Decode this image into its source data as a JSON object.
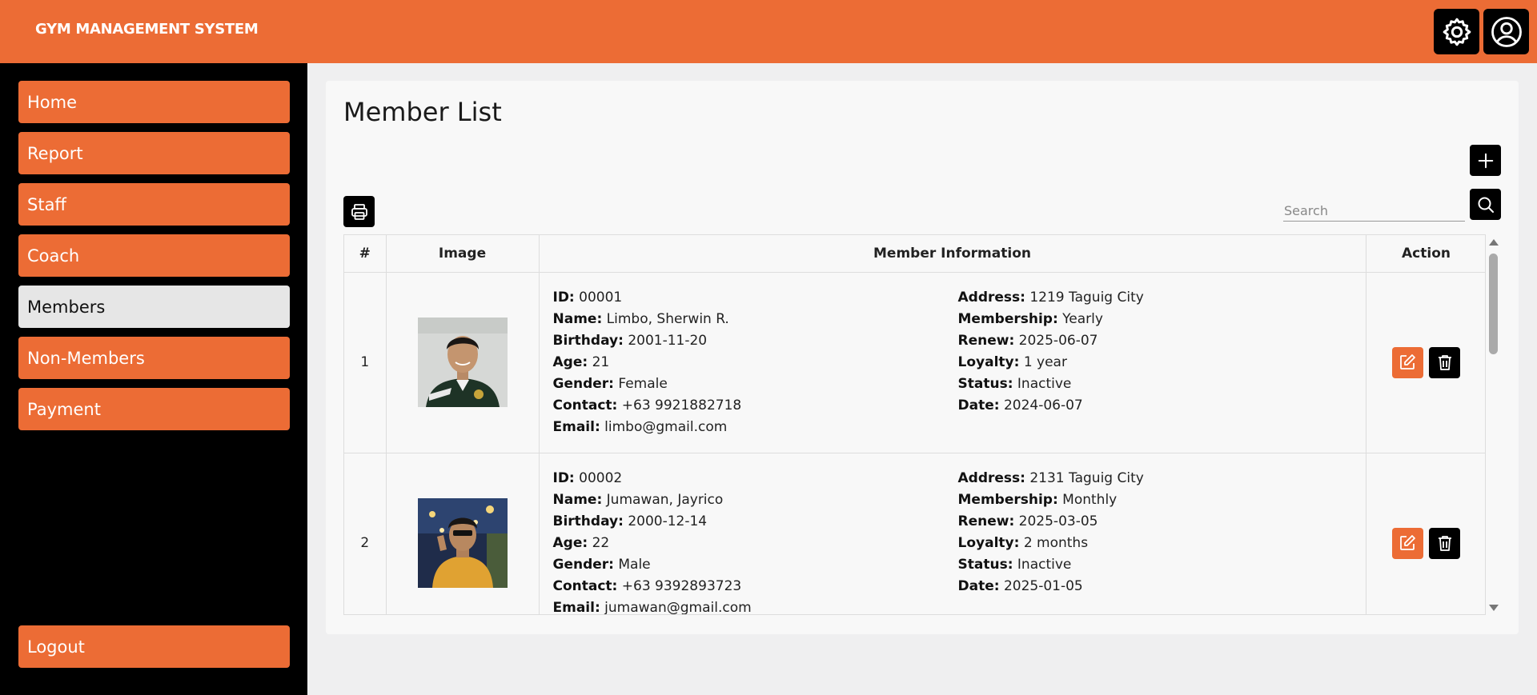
{
  "app": {
    "title": "GYM MANAGEMENT SYSTEM"
  },
  "header": {
    "settings_icon": "gear-icon",
    "profile_icon": "user-circle-icon"
  },
  "sidebar": {
    "items": [
      {
        "label": "Home"
      },
      {
        "label": "Report"
      },
      {
        "label": "Staff"
      },
      {
        "label": "Coach"
      },
      {
        "label": "Members",
        "active": true
      },
      {
        "label": "Non-Members"
      },
      {
        "label": "Payment"
      }
    ],
    "logout": "Logout"
  },
  "page": {
    "title": "Member List",
    "search_placeholder": "Search"
  },
  "table": {
    "headers": {
      "num": "#",
      "image": "Image",
      "info": "Member Information",
      "action": "Action"
    },
    "labels": {
      "id": "ID:",
      "name": "Name:",
      "birthday": "Birthday:",
      "age": "Age:",
      "gender": "Gender:",
      "contact": "Contact:",
      "email": "Email:",
      "address": "Address:",
      "membership": "Membership:",
      "renew": "Renew:",
      "loyalty": "Loyalty:",
      "status": "Status:",
      "date": "Date:"
    },
    "rows": [
      {
        "num": "1",
        "id": "00001",
        "name": "Limbo, Sherwin R.",
        "birthday": "2001-11-20",
        "age": "21",
        "gender": "Female",
        "contact": "+63 9921882718",
        "email": "limbo@gmail.com",
        "address": "1219 Taguig City",
        "membership": "Yearly",
        "renew": "2025-06-07",
        "loyalty": "1 year",
        "status": "Inactive",
        "date": "2024-06-07"
      },
      {
        "num": "2",
        "id": "00002",
        "name": "Jumawan, Jayrico",
        "birthday": "2000-12-14",
        "age": "22",
        "gender": "Male",
        "contact": "+63 9392893723",
        "email": "jumawan@gmail.com",
        "address": "2131 Taguig City",
        "membership": "Monthly",
        "renew": "2025-03-05",
        "loyalty": "2 months",
        "status": "Inactive",
        "date": "2025-01-05"
      }
    ]
  },
  "colors": {
    "accent": "#ec6c35",
    "sidebar": "#000000",
    "active_nav": "#e6e6e6"
  }
}
